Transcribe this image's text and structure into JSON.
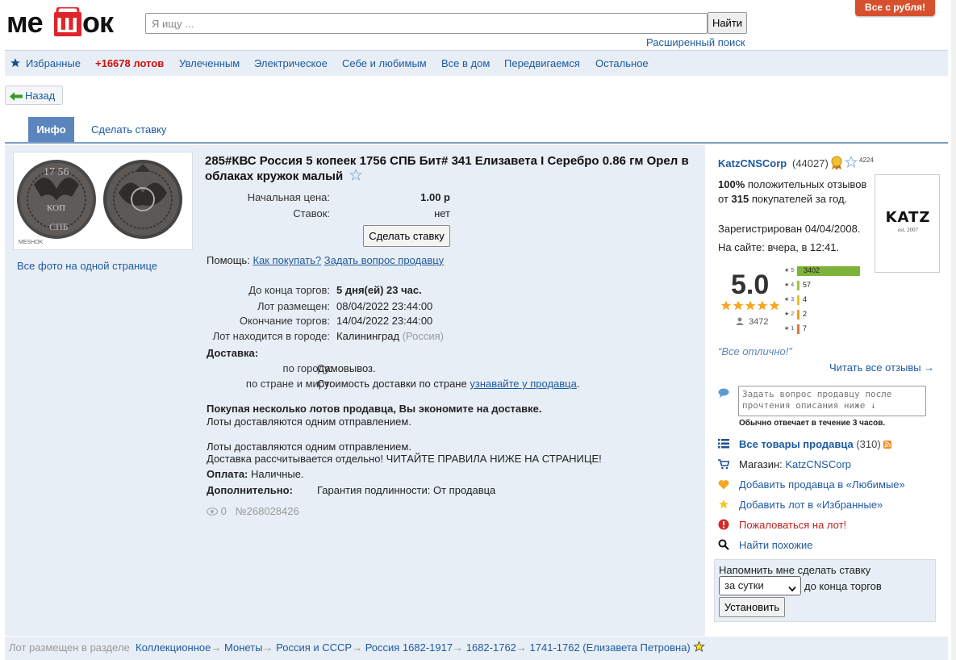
{
  "header": {
    "logo_text": "мешок",
    "search_placeholder": "Я ищу ...",
    "search_button": "Найти",
    "advanced_search": "Расширенный поиск",
    "promo": "Все с рубля!"
  },
  "nav": {
    "favorites": "Избранные",
    "lots_count": "+16678 лотов",
    "items": [
      "Увлеченным",
      "Электрическое",
      "Себе и любимым",
      "Все в дом",
      "Передвигаемся",
      "Остальное"
    ]
  },
  "back_label": "Назад",
  "tabs": {
    "info": "Инфо",
    "bid": "Сделать ставку"
  },
  "photos": {
    "all_link": "Все фото на одной странице",
    "watermark": "MESHOK"
  },
  "lot": {
    "title": "285#КВС Россия 5 копеек 1756 СПБ Бит# 341 Елизавета I Серебро 0.86 гм Орел в облаках кружок малый",
    "start_price_label": "Начальная цена:",
    "start_price": "1.00 р",
    "bids_label": "Ставок:",
    "bids": "нет",
    "bid_button": "Сделать ставку",
    "help_label": "Помощь:",
    "help_how": "Как покупать?",
    "help_ask": "Задать вопрос продавцу",
    "ends_in_label": "До конца торгов:",
    "ends_in": "5 дня(ей) 23 час.",
    "placed_label": "Лот размещен:",
    "placed": "08/04/2022 23:44:00",
    "end_label": "Окончание торгов:",
    "end": "14/04/2022 23:44:00",
    "city_label": "Лот находится в городе:",
    "city": "Калининград",
    "country": "(Россия)",
    "delivery_label": "Доставка:",
    "city_delivery_label": "по городу:",
    "city_delivery": "Самовывоз.",
    "world_delivery_label": "по стране и миру:",
    "world_delivery": "Стоимость доставки по стране",
    "world_delivery_link": "узнавайте у продавца",
    "save_line": "Покупая несколько лотов продавца, Вы экономите на доставке.",
    "one_shipment": "Лоты доставляются одним отправлением.",
    "one_shipment2": "Лоты доставляются одним отправлением.",
    "shipping_note": "Доставка рассчитывается отдельно! ЧИТАЙТЕ ПРАВИЛА НИЖЕ НА СТРАНИЦЕ!",
    "payment_label": "Оплата:",
    "payment": "Наличные.",
    "extra_label": "Дополнительно:",
    "extra": "Гарантия подлинности: От продавца",
    "views": "0",
    "lot_id": "№268028426"
  },
  "seller": {
    "name": "KatzCNSCorp",
    "rating_count": "(44027)",
    "stars_count": "4224",
    "positive_pct": "100%",
    "positive_text": "положительных отзывов от",
    "buyers": "315",
    "buyers_text": "покупателей за год.",
    "registered": "Зарегистрирован 04/04/2008.",
    "online": "На сайте: вчера, в 12:41.",
    "logo_text": "KATZ",
    "logo_sub": "est. 2007",
    "score": "5.0",
    "reviews_total": "3472",
    "rating_bars": [
      {
        "star": "5",
        "count": "3402",
        "fraction": 1.0,
        "color": "#7fb23a"
      },
      {
        "star": "4",
        "count": "57",
        "fraction": 0.017,
        "color": "#a4c43a"
      },
      {
        "star": "3",
        "count": "4",
        "fraction": 0.002,
        "color": "#f0c21a"
      },
      {
        "star": "2",
        "count": "2",
        "fraction": 0.001,
        "color": "#f0a01a"
      },
      {
        "star": "1",
        "count": "7",
        "fraction": 0.002,
        "color": "#e2753a"
      }
    ],
    "quote": "“Все отлично!”",
    "read_all": "Читать все отзывы →",
    "ask_placeholder": "Задать вопрос продавцу после прочтения описания ниже ↓",
    "reply_time": "Обычно отвечает в течение 3 часов.",
    "all_items": "Все товары продавца",
    "all_items_count": "(310)",
    "shop_label": "Магазин:",
    "shop": "KatzCNSCorp",
    "add_fav_seller": "Добавить продавца в «Любимые»",
    "add_fav_lot": "Добавить лот в «Избранные»",
    "complain": "Пожаловаться на лот!",
    "similar": "Найти похожие"
  },
  "reminder": {
    "title": "Напомнить мне сделать ставку",
    "select_value": "за сутки",
    "suffix": "до конца торгов",
    "button": "Установить"
  },
  "footer": {
    "placed_in": "Лот размещен в разделе",
    "crumbs": [
      "Коллекционное",
      "Монеты",
      "Россия и СССР",
      "Россия 1682-1917",
      "1682-1762",
      "1741-1762 (Елизавета Петровна)"
    ]
  }
}
